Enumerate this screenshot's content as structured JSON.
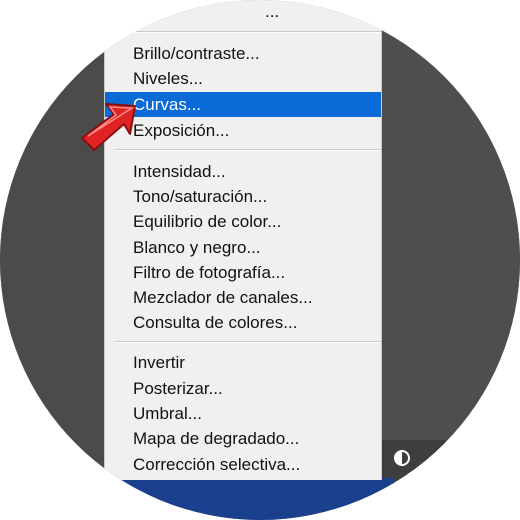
{
  "menu": {
    "top_partial": "...",
    "group1": [
      "Brillo/contraste...",
      "Niveles...",
      "Curvas...",
      "Exposición..."
    ],
    "group2": [
      "Intensidad...",
      "Tono/saturación...",
      "Equilibrio de color...",
      "Blanco y negro...",
      "Filtro de fotografía...",
      "Mezclador de canales...",
      "Consulta de colores..."
    ],
    "group3": [
      "Invertir",
      "Posterizar...",
      "Umbral...",
      "Mapa de degradado...",
      "Corrección selectiva..."
    ],
    "selected_item": "Curvas..."
  },
  "colors": {
    "highlight": "#0a6ad6",
    "arrow": "#e02424",
    "status_bar": "#1a3f8c"
  },
  "icons": {
    "pointer": "red-pointer-arrow-icon",
    "layer_mask": "half-circle-adjustment-icon"
  }
}
